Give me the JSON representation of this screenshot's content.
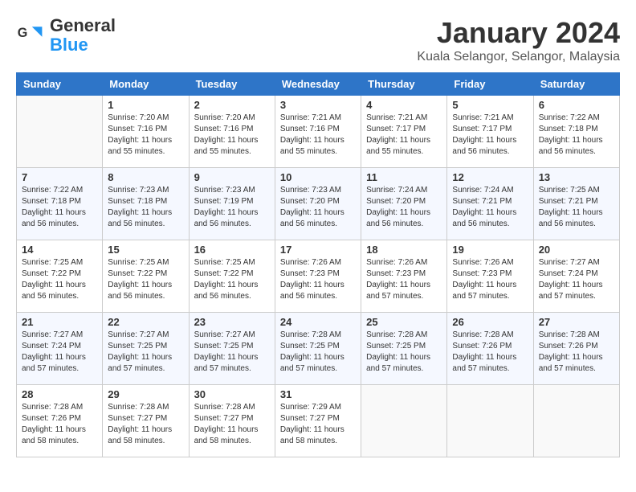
{
  "header": {
    "logo_general": "General",
    "logo_blue": "Blue",
    "month_title": "January 2024",
    "location": "Kuala Selangor, Selangor, Malaysia"
  },
  "weekdays": [
    "Sunday",
    "Monday",
    "Tuesday",
    "Wednesday",
    "Thursday",
    "Friday",
    "Saturday"
  ],
  "weeks": [
    [
      {
        "day": "",
        "sunrise": "",
        "sunset": "",
        "daylight": ""
      },
      {
        "day": "1",
        "sunrise": "Sunrise: 7:20 AM",
        "sunset": "Sunset: 7:16 PM",
        "daylight": "Daylight: 11 hours and 55 minutes."
      },
      {
        "day": "2",
        "sunrise": "Sunrise: 7:20 AM",
        "sunset": "Sunset: 7:16 PM",
        "daylight": "Daylight: 11 hours and 55 minutes."
      },
      {
        "day": "3",
        "sunrise": "Sunrise: 7:21 AM",
        "sunset": "Sunset: 7:16 PM",
        "daylight": "Daylight: 11 hours and 55 minutes."
      },
      {
        "day": "4",
        "sunrise": "Sunrise: 7:21 AM",
        "sunset": "Sunset: 7:17 PM",
        "daylight": "Daylight: 11 hours and 55 minutes."
      },
      {
        "day": "5",
        "sunrise": "Sunrise: 7:21 AM",
        "sunset": "Sunset: 7:17 PM",
        "daylight": "Daylight: 11 hours and 56 minutes."
      },
      {
        "day": "6",
        "sunrise": "Sunrise: 7:22 AM",
        "sunset": "Sunset: 7:18 PM",
        "daylight": "Daylight: 11 hours and 56 minutes."
      }
    ],
    [
      {
        "day": "7",
        "sunrise": "Sunrise: 7:22 AM",
        "sunset": "Sunset: 7:18 PM",
        "daylight": "Daylight: 11 hours and 56 minutes."
      },
      {
        "day": "8",
        "sunrise": "Sunrise: 7:23 AM",
        "sunset": "Sunset: 7:18 PM",
        "daylight": "Daylight: 11 hours and 56 minutes."
      },
      {
        "day": "9",
        "sunrise": "Sunrise: 7:23 AM",
        "sunset": "Sunset: 7:19 PM",
        "daylight": "Daylight: 11 hours and 56 minutes."
      },
      {
        "day": "10",
        "sunrise": "Sunrise: 7:23 AM",
        "sunset": "Sunset: 7:20 PM",
        "daylight": "Daylight: 11 hours and 56 minutes."
      },
      {
        "day": "11",
        "sunrise": "Sunrise: 7:24 AM",
        "sunset": "Sunset: 7:20 PM",
        "daylight": "Daylight: 11 hours and 56 minutes."
      },
      {
        "day": "12",
        "sunrise": "Sunrise: 7:24 AM",
        "sunset": "Sunset: 7:21 PM",
        "daylight": "Daylight: 11 hours and 56 minutes."
      },
      {
        "day": "13",
        "sunrise": "Sunrise: 7:25 AM",
        "sunset": "Sunset: 7:21 PM",
        "daylight": "Daylight: 11 hours and 56 minutes."
      }
    ],
    [
      {
        "day": "14",
        "sunrise": "Sunrise: 7:25 AM",
        "sunset": "Sunset: 7:22 PM",
        "daylight": "Daylight: 11 hours and 56 minutes."
      },
      {
        "day": "15",
        "sunrise": "Sunrise: 7:25 AM",
        "sunset": "Sunset: 7:22 PM",
        "daylight": "Daylight: 11 hours and 56 minutes."
      },
      {
        "day": "16",
        "sunrise": "Sunrise: 7:25 AM",
        "sunset": "Sunset: 7:22 PM",
        "daylight": "Daylight: 11 hours and 56 minutes."
      },
      {
        "day": "17",
        "sunrise": "Sunrise: 7:26 AM",
        "sunset": "Sunset: 7:23 PM",
        "daylight": "Daylight: 11 hours and 56 minutes."
      },
      {
        "day": "18",
        "sunrise": "Sunrise: 7:26 AM",
        "sunset": "Sunset: 7:23 PM",
        "daylight": "Daylight: 11 hours and 57 minutes."
      },
      {
        "day": "19",
        "sunrise": "Sunrise: 7:26 AM",
        "sunset": "Sunset: 7:23 PM",
        "daylight": "Daylight: 11 hours and 57 minutes."
      },
      {
        "day": "20",
        "sunrise": "Sunrise: 7:27 AM",
        "sunset": "Sunset: 7:24 PM",
        "daylight": "Daylight: 11 hours and 57 minutes."
      }
    ],
    [
      {
        "day": "21",
        "sunrise": "Sunrise: 7:27 AM",
        "sunset": "Sunset: 7:24 PM",
        "daylight": "Daylight: 11 hours and 57 minutes."
      },
      {
        "day": "22",
        "sunrise": "Sunrise: 7:27 AM",
        "sunset": "Sunset: 7:25 PM",
        "daylight": "Daylight: 11 hours and 57 minutes."
      },
      {
        "day": "23",
        "sunrise": "Sunrise: 7:27 AM",
        "sunset": "Sunset: 7:25 PM",
        "daylight": "Daylight: 11 hours and 57 minutes."
      },
      {
        "day": "24",
        "sunrise": "Sunrise: 7:28 AM",
        "sunset": "Sunset: 7:25 PM",
        "daylight": "Daylight: 11 hours and 57 minutes."
      },
      {
        "day": "25",
        "sunrise": "Sunrise: 7:28 AM",
        "sunset": "Sunset: 7:25 PM",
        "daylight": "Daylight: 11 hours and 57 minutes."
      },
      {
        "day": "26",
        "sunrise": "Sunrise: 7:28 AM",
        "sunset": "Sunset: 7:26 PM",
        "daylight": "Daylight: 11 hours and 57 minutes."
      },
      {
        "day": "27",
        "sunrise": "Sunrise: 7:28 AM",
        "sunset": "Sunset: 7:26 PM",
        "daylight": "Daylight: 11 hours and 57 minutes."
      }
    ],
    [
      {
        "day": "28",
        "sunrise": "Sunrise: 7:28 AM",
        "sunset": "Sunset: 7:26 PM",
        "daylight": "Daylight: 11 hours and 58 minutes."
      },
      {
        "day": "29",
        "sunrise": "Sunrise: 7:28 AM",
        "sunset": "Sunset: 7:27 PM",
        "daylight": "Daylight: 11 hours and 58 minutes."
      },
      {
        "day": "30",
        "sunrise": "Sunrise: 7:28 AM",
        "sunset": "Sunset: 7:27 PM",
        "daylight": "Daylight: 11 hours and 58 minutes."
      },
      {
        "day": "31",
        "sunrise": "Sunrise: 7:29 AM",
        "sunset": "Sunset: 7:27 PM",
        "daylight": "Daylight: 11 hours and 58 minutes."
      },
      {
        "day": "",
        "sunrise": "",
        "sunset": "",
        "daylight": ""
      },
      {
        "day": "",
        "sunrise": "",
        "sunset": "",
        "daylight": ""
      },
      {
        "day": "",
        "sunrise": "",
        "sunset": "",
        "daylight": ""
      }
    ]
  ]
}
